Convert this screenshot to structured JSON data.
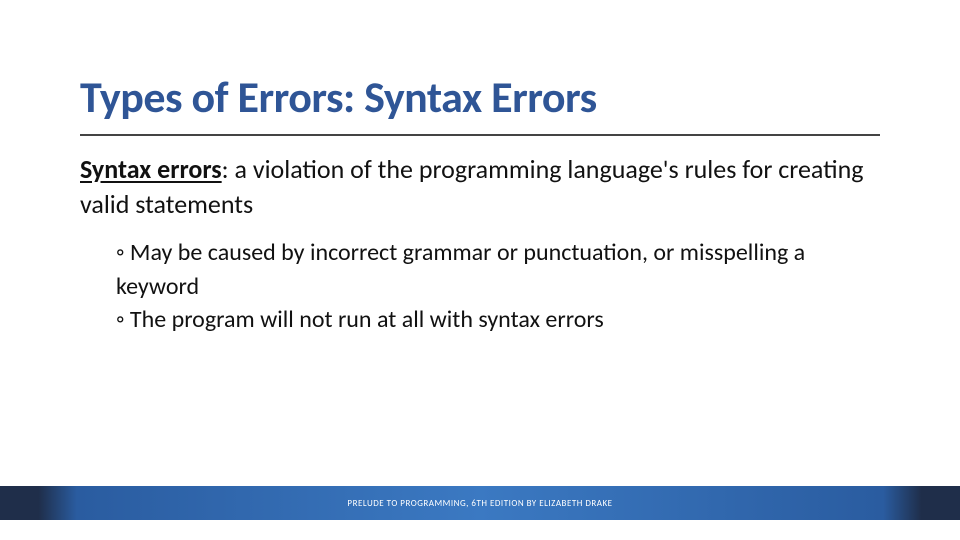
{
  "slide": {
    "title": "Types of Errors: Syntax Errors",
    "definition": {
      "term": "Syntax errors",
      "rest": ": a violation of the programming language's rules for creating valid statements"
    },
    "bullets": [
      "May be caused by incorrect grammar or punctuation, or misspelling a keyword",
      "The program will not run at all with syntax errors"
    ],
    "footer": "PRELUDE TO PROGRAMMING, 6TH EDITION BY ELIZABETH DRAKE"
  }
}
